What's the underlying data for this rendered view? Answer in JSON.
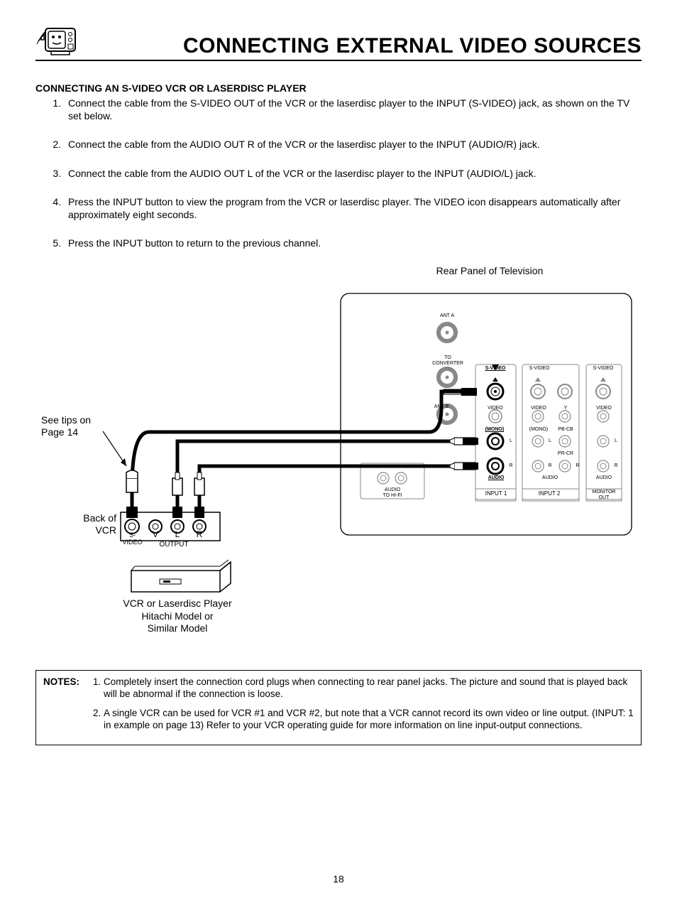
{
  "header": {
    "title": "Connecting External Video Sources"
  },
  "subheading": "CONNECTING AN S-VIDEO VCR OR LASERDISC PLAYER",
  "steps": [
    "Connect the cable from the S-VIDEO OUT of the VCR or the laserdisc player to the INPUT (S-VIDEO) jack, as shown on the TV set below.",
    "Connect the cable from the AUDIO OUT R of the VCR or the laserdisc player to the INPUT (AUDIO/R) jack.",
    "Connect the cable from the AUDIO OUT L of the VCR or the laserdisc player to the INPUT (AUDIO/L) jack.",
    "Press the INPUT button to view the program from the VCR or laserdisc player.  The VIDEO icon disappears automatically after approximately eight seconds.",
    "Press the INPUT button to return to the previous channel."
  ],
  "diagram": {
    "panel_title": "Rear Panel of Television",
    "see_tips": "See tips on\nPage 14",
    "back_of_vcr": "Back of\nVCR",
    "vcr_label": "VCR or Laserdisc Player",
    "hitachi_label": "Hitachi Model or\nSimilar Model",
    "svideo": "S-VIDEO",
    "v": "V",
    "l": "L",
    "r": "R",
    "output": "OUTPUT",
    "ant_a": "ANT A",
    "to_converter": "TO\nCONVERTER",
    "ant_b": "ANT B",
    "audio_to_hifi": "AUDIO\nTO HI-FI",
    "video": "VIDEO",
    "mono": "(MONO)",
    "audio": "AUDIO",
    "input1": "INPUT 1",
    "input2": "INPUT 2",
    "monitor_out": "MONITOR\nOUT",
    "y": "Y",
    "pbcb": "PB-CB",
    "prcr": "PR-CR"
  },
  "notes": {
    "label": "NOTES:",
    "items": [
      "Completely insert the connection cord plugs when connecting to rear panel jacks.  The picture and sound that is played back will be abnormal if the connection is loose.",
      "A single VCR can be used for VCR #1 and VCR #2, but note that a VCR cannot record its own video or line output.  (INPUT: 1 in example on page 13)  Refer to your VCR operating guide for more information on line input-output connections."
    ]
  },
  "page_number": "18"
}
